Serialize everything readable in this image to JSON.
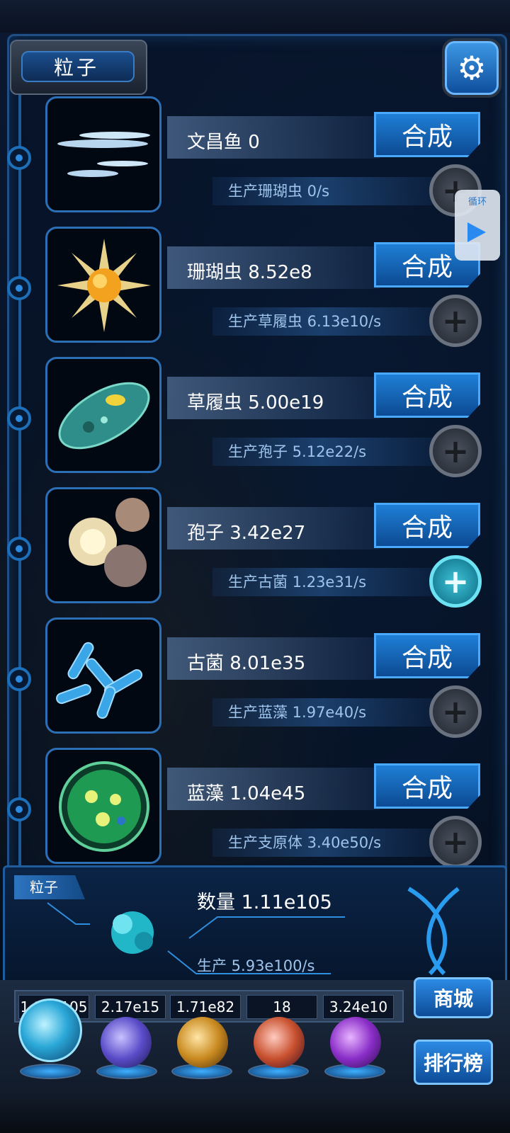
{
  "header": {
    "title": "粒子"
  },
  "items": [
    {
      "name": "文昌鱼 0",
      "production": "生产珊瑚虫 0/s",
      "merge_label": "合成",
      "plus_active": false
    },
    {
      "name": "珊瑚虫 8.52e8",
      "production": "生产草履虫 6.13e10/s",
      "merge_label": "合成",
      "plus_active": false
    },
    {
      "name": "草履虫 5.00e19",
      "production": "生产孢子 5.12e22/s",
      "merge_label": "合成",
      "plus_active": false
    },
    {
      "name": "孢子 3.42e27",
      "production": "生产古菌 1.23e31/s",
      "merge_label": "合成",
      "plus_active": true
    },
    {
      "name": "古菌 8.01e35",
      "production": "生产蓝藻 1.97e40/s",
      "merge_label": "合成",
      "plus_active": false
    },
    {
      "name": "蓝藻 1.04e45",
      "production": "生产支原体 3.40e50/s",
      "merge_label": "合成",
      "plus_active": false
    }
  ],
  "loop_button": {
    "label": "循环"
  },
  "summary": {
    "tag": "粒子",
    "count": "数量 1.11e105",
    "rate": "生产 5.93e100/s"
  },
  "dock": {
    "counts": [
      "1.11e105",
      "2.17e15",
      "1.71e82",
      "18",
      "3.24e10"
    ],
    "shop_label": "商城",
    "rank_label": "排行榜"
  }
}
